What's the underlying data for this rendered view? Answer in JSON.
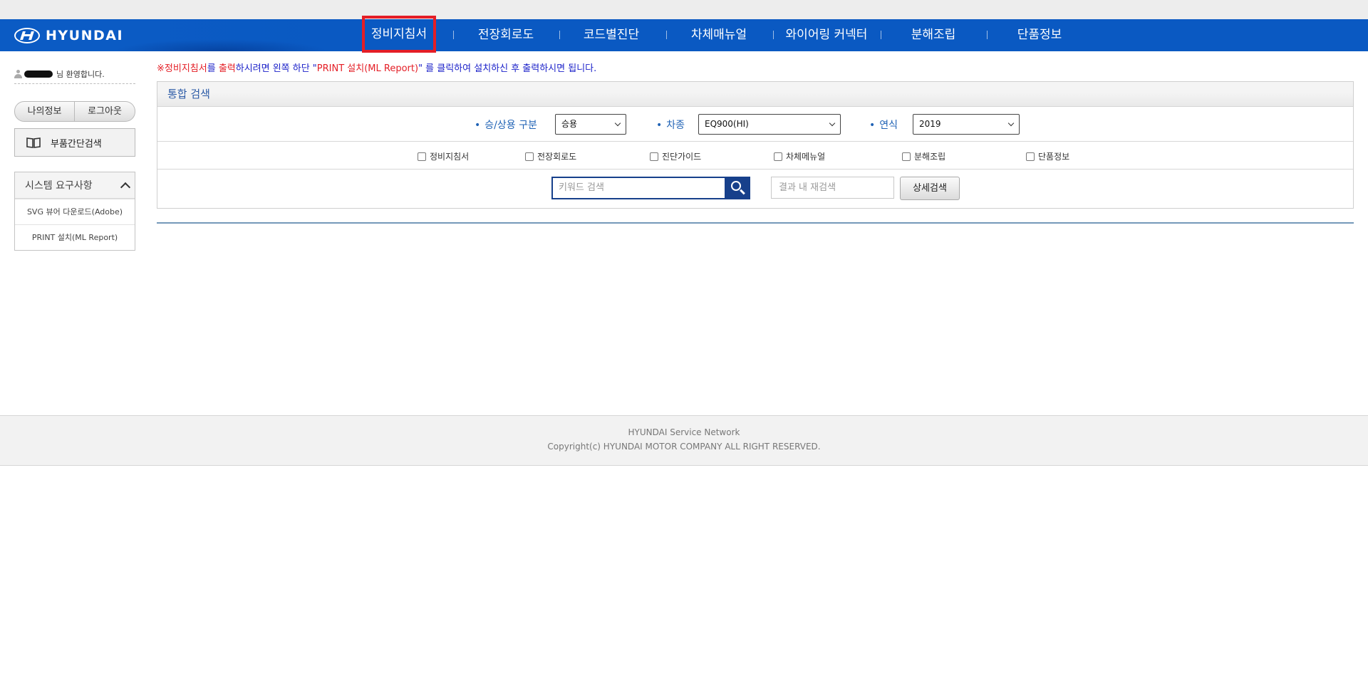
{
  "brand": {
    "logo_text": "HYUNDAI"
  },
  "nav": {
    "items": [
      {
        "label": "정비지침서",
        "active": true
      },
      {
        "label": "전장회로도"
      },
      {
        "label": "코드별진단"
      },
      {
        "label": "차체매뉴얼"
      },
      {
        "label": "와이어링 커넥터"
      },
      {
        "label": "분해조립"
      },
      {
        "label": "단품정보"
      }
    ],
    "active_color": "#e41e26",
    "bar_color": "#0a59c2"
  },
  "sidebar": {
    "welcome_suffix": "님 환영합니다.",
    "my_info": "나의정보",
    "logout": "로그아웃",
    "parts_search": "부품간단검색",
    "requirements": {
      "title": "시스템 요구사항",
      "items": [
        "SVG 뷰어 다운로드(Adobe)",
        "PRINT 설치(ML Report)"
      ]
    }
  },
  "notice": {
    "prefix": "※",
    "part1": "정비지침서",
    "part2": "를 ",
    "part3": "출력",
    "part4": "하시려면 왼쪽 하단 \"",
    "part5": "PRINT 설치(ML Report)",
    "part6": "\" 를 클릭하여 설치하신 후 출력하시면 됩니다."
  },
  "search": {
    "title": "통합 검색",
    "fields": {
      "category_label": "승/상용 구분",
      "category_value": "승용",
      "model_label": "차종",
      "model_value": "EQ900(HI)",
      "year_label": "연식",
      "year_value": "2019"
    },
    "checkboxes": [
      "정비지침서",
      "전장회로도",
      "진단가이드",
      "차체메뉴얼",
      "분해조립",
      "단품정보"
    ],
    "keyword_placeholder": "키워드 검색",
    "research_placeholder": "결과 내 재검색",
    "advanced_button": "상세검색"
  },
  "footer": {
    "line1": "HYUNDAI Service Network",
    "line2": "Copyright(c) HYUNDAI MOTOR COMPANY ALL RIGHT RESERVED."
  }
}
